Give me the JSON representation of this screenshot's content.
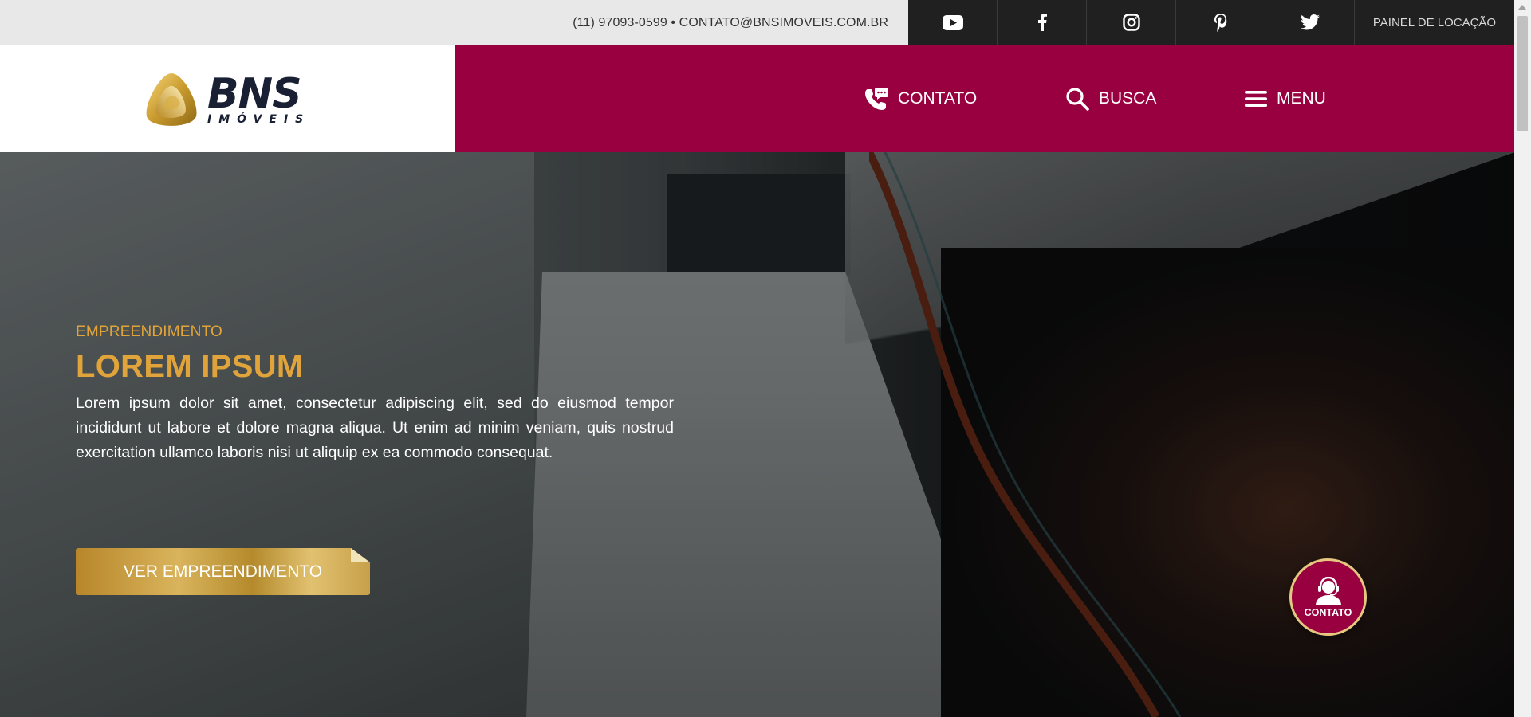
{
  "topbar": {
    "contact_line": "(11) 97093-0599 • CONTATO@BNSIMOVEIS.COM.BR",
    "social": [
      {
        "icon": "youtube-icon"
      },
      {
        "icon": "facebook-icon"
      },
      {
        "icon": "instagram-icon"
      },
      {
        "icon": "pinterest-icon"
      },
      {
        "icon": "twitter-icon"
      }
    ],
    "painel_label": "PAINEL DE LOCAÇÃO"
  },
  "header": {
    "logo_word": "BNS",
    "logo_sub": "IMÓVEIS",
    "nav": {
      "contato": "CONTATO",
      "busca": "BUSCA",
      "menu": "MENU"
    }
  },
  "hero": {
    "eyebrow": "EMPREENDIMENTO",
    "title": "LOREM IPSUM",
    "text": "Lorem ipsum dolor sit amet, consectetur adipiscing elit, sed do eiusmod tempor incididunt ut labore et dolore magna aliqua. Ut enim ad minim veniam, quis nostrud exercitation ullamco laboris nisi ut aliquip ex ea commodo consequat.",
    "cta_label": "VER EMPREENDIMENTO"
  },
  "float_contact": {
    "label": "CONTATO"
  },
  "colors": {
    "brand": "#990040",
    "gold": "#e0a43a",
    "dark": "#202020"
  }
}
